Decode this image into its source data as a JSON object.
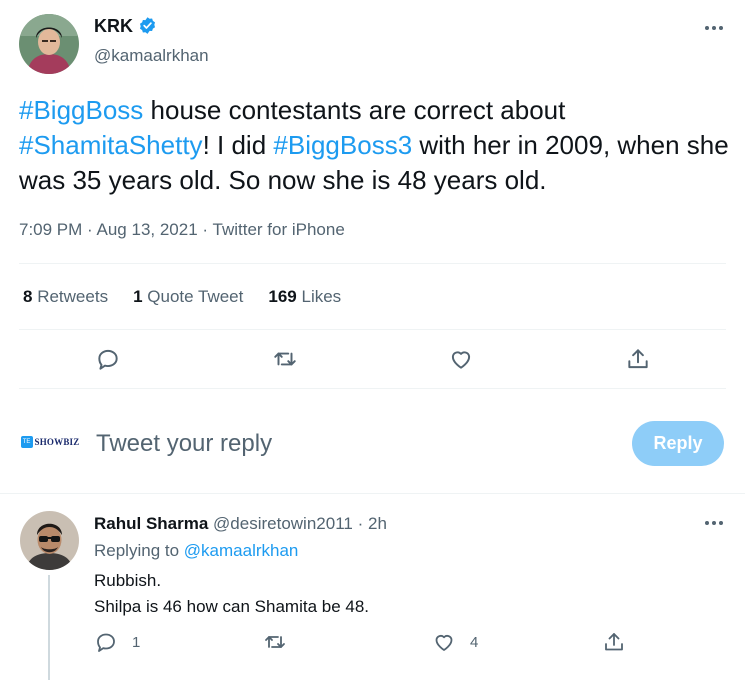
{
  "tweet": {
    "author_name": "KRK",
    "author_handle": "@kamaalrkhan",
    "text_parts": [
      {
        "text": "#BiggBoss",
        "hashtag": true
      },
      {
        "text": " house contestants are correct about ",
        "hashtag": false
      },
      {
        "text": "#ShamitaShetty",
        "hashtag": true
      },
      {
        "text": "! I did ",
        "hashtag": false
      },
      {
        "text": "#BiggBoss3",
        "hashtag": true
      },
      {
        "text": " with her in 2009, when she was 35 years old. So now she is 48 years old.",
        "hashtag": false
      }
    ],
    "time": "7:09 PM",
    "date": "Aug 13, 2021",
    "source": "Twitter for iPhone",
    "separator": "·",
    "stats": {
      "retweets_count": "8",
      "retweets_label": "Retweets",
      "quotes_count": "1",
      "quotes_label": "Quote Tweet",
      "likes_count": "169",
      "likes_label": "Likes"
    }
  },
  "composer": {
    "avatar_text": "SHOWBIZ",
    "placeholder": "Tweet your reply",
    "button_label": "Reply"
  },
  "reply": {
    "author_name": "Rahul Sharma",
    "author_handle": "@desiretowin2011",
    "time_ago": "2h",
    "separator": "·",
    "replying_prefix": "Replying to",
    "replying_to": "@kamaalrkhan",
    "line1": "Rubbish.",
    "line2": "Shilpa is 46 how can Shamita be 48.",
    "reply_count": "1",
    "like_count": "4"
  },
  "colors": {
    "accent": "#1d9bf0",
    "text": "#0f1419",
    "muted": "#536471",
    "reply_button_disabled": "#8ecdf8"
  },
  "icons": [
    "verified-badge-icon",
    "more-icon",
    "reply-icon",
    "retweet-icon",
    "like-icon",
    "share-icon"
  ]
}
